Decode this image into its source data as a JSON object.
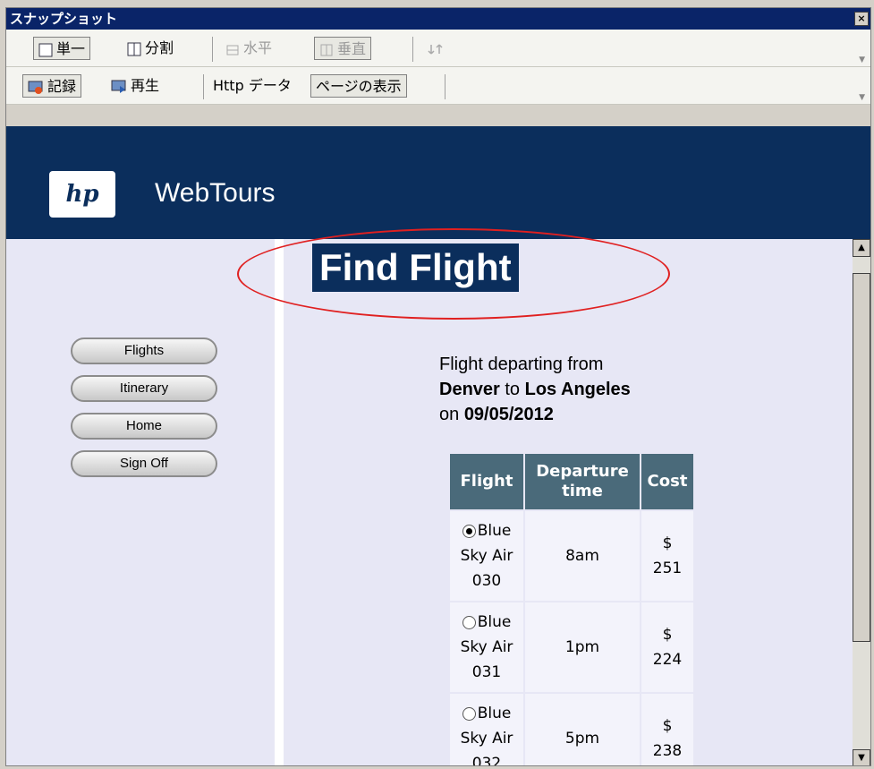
{
  "window": {
    "title": "スナップショット",
    "close_glyph": "×"
  },
  "toolbar1": {
    "single": "単一",
    "split": "分割",
    "horizontal": "水平",
    "vertical": "垂直"
  },
  "toolbar2": {
    "record": "記録",
    "playback": "再生",
    "http_data": "Http データ",
    "page_view": "ページの表示"
  },
  "header": {
    "logo_text": "hp",
    "brand": "WebTours"
  },
  "nav": {
    "items": [
      "Flights",
      "Itinerary",
      "Home",
      "Sign Off"
    ]
  },
  "main": {
    "title": "Find Flight",
    "info_line1": "Flight departing from",
    "from": "Denver",
    "to_word": "to",
    "to": "Los Angeles",
    "on_word": "on",
    "date": "09/05/2012"
  },
  "table": {
    "headers": [
      "Flight",
      "Departure time",
      "Cost"
    ],
    "rows": [
      {
        "flight_l1": "Blue",
        "flight_l2": "Sky Air",
        "flight_l3": "030",
        "time": "8am",
        "cost_sym": "$",
        "cost": "251",
        "selected": true
      },
      {
        "flight_l1": "Blue",
        "flight_l2": "Sky Air",
        "flight_l3": "031",
        "time": "1pm",
        "cost_sym": "$",
        "cost": "224",
        "selected": false
      },
      {
        "flight_l1": "Blue",
        "flight_l2": "Sky Air",
        "flight_l3": "032",
        "time": "5pm",
        "cost_sym": "$",
        "cost": "238",
        "selected": false
      }
    ]
  },
  "colors": {
    "header_bg": "#0b2e5c",
    "content_bg": "#e7e7f5",
    "annotation": "#e02020",
    "table_header": "#4a6a7a"
  },
  "icons": [
    "close-icon",
    "single-view-icon",
    "split-view-icon",
    "horizontal-icon",
    "vertical-icon",
    "sync-icon",
    "record-icon",
    "playback-icon",
    "chevron-down-icon",
    "scroll-up-icon",
    "scroll-down-icon",
    "radio-icon"
  ]
}
